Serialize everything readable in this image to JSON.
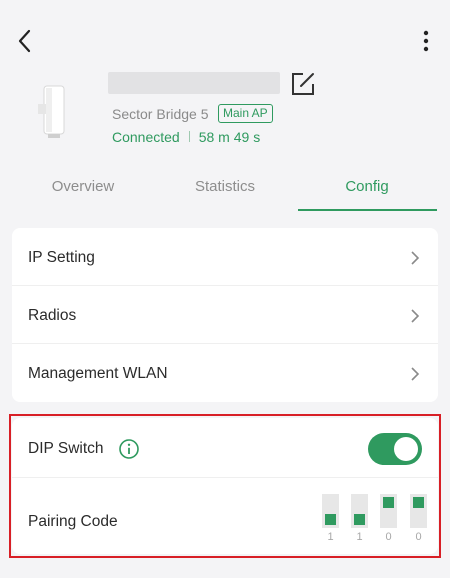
{
  "header": {
    "back_icon": "back-arrow-icon",
    "more_icon": "more-vertical-icon"
  },
  "device": {
    "model": "Sector Bridge 5",
    "role_badge": "Main AP",
    "status": "Connected",
    "uptime": "58 m 49 s"
  },
  "tabs": [
    {
      "label": "Overview",
      "active": false
    },
    {
      "label": "Statistics",
      "active": false
    },
    {
      "label": "Config",
      "active": true
    }
  ],
  "config_items": [
    {
      "label": "IP Setting"
    },
    {
      "label": "Radios"
    },
    {
      "label": "Management WLAN"
    }
  ],
  "dip_section": {
    "dip_switch_label": "DIP Switch",
    "dip_switch_enabled": true,
    "pairing_code_label": "Pairing Code",
    "pairing_code_bits": [
      "1",
      "1",
      "0",
      "0"
    ]
  },
  "colors": {
    "accent": "#2f9a5f",
    "highlight": "#d81f26"
  }
}
